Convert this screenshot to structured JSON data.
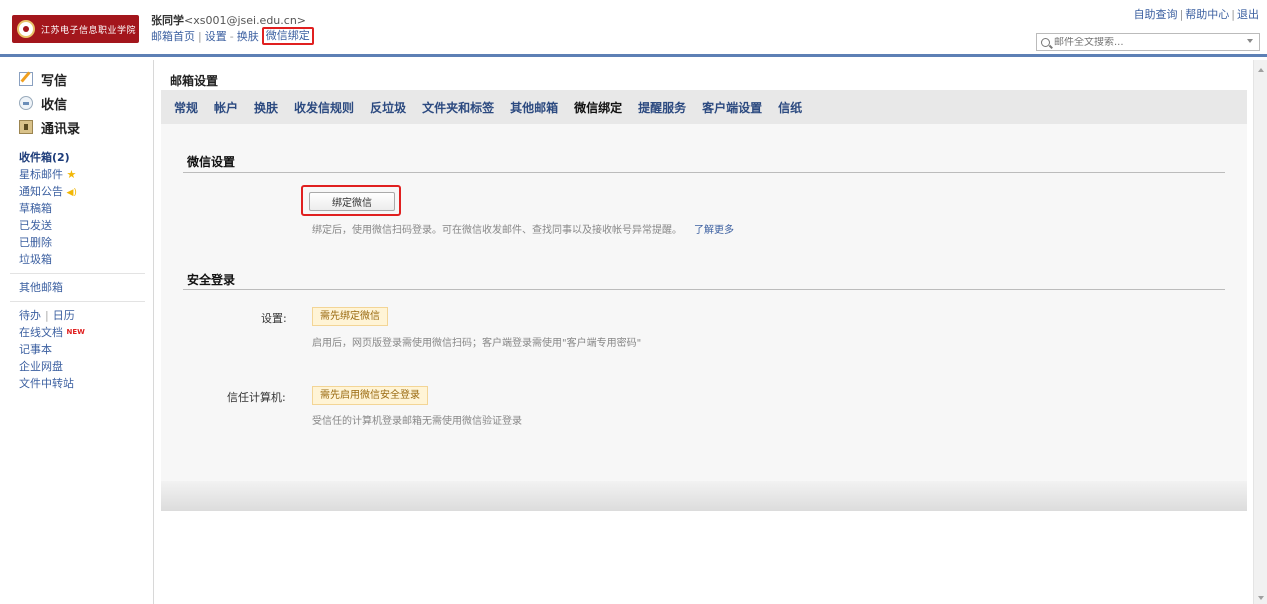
{
  "header": {
    "logo_text": "江苏电子信息职业学院",
    "user_name": "张同学",
    "user_email": "<xs001@jsei.edu.cn>",
    "links": [
      "邮箱首页",
      "设置",
      "换肤",
      "微信绑定"
    ],
    "top_links": [
      "自助查询",
      "帮助中心",
      "退出"
    ],
    "search_placeholder": "邮件全文搜索...",
    "highlight_color": "#e02020"
  },
  "sidebar": {
    "main_items": [
      {
        "label": "写信",
        "icon": "write-icon"
      },
      {
        "label": "收信",
        "icon": "inbox-icon"
      },
      {
        "label": "通讯录",
        "icon": "contacts-icon"
      }
    ],
    "folders": [
      "收件箱(2)",
      "星标邮件",
      "通知公告",
      "草稿箱",
      "已发送",
      "已删除",
      "垃圾箱"
    ],
    "other_mailbox": "其他邮箱",
    "tools": {
      "todo": "待办",
      "calendar": "日历",
      "online_docs": "在线文档",
      "new_badge": "NEW",
      "notes": "记事本",
      "netdisk": "企业网盘",
      "transfer": "文件中转站"
    }
  },
  "main": {
    "page_title": "邮箱设置",
    "tabs": [
      "常规",
      "帐户",
      "换肤",
      "收发信规则",
      "反垃圾",
      "文件夹和标签",
      "其他邮箱",
      "微信绑定",
      "提醒服务",
      "客户端设置",
      "信纸"
    ],
    "active_tab": "微信绑定",
    "wechat_section": {
      "title": "微信设置",
      "bind_button": "绑定微信",
      "description": "绑定后，使用微信扫码登录。可在微信收发邮件、查找同事以及接收帐号异常提醒。",
      "learn_more": "了解更多"
    },
    "security_section": {
      "title": "安全登录",
      "setting_label": "设置:",
      "setting_tag": "需先绑定微信",
      "setting_desc": "启用后，网页版登录需使用微信扫码；客户端登录需使用\"客户端专用密码\"",
      "trusted_label": "信任计算机:",
      "trusted_tag": "需先启用微信安全登录",
      "trusted_desc": "受信任的计算机登录邮箱无需使用微信验证登录"
    }
  }
}
